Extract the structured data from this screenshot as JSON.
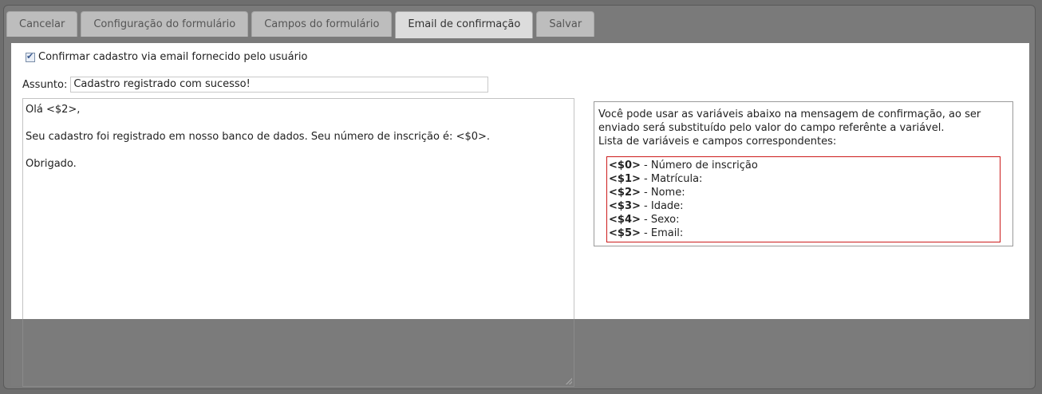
{
  "tabs": [
    {
      "label": "Cancelar"
    },
    {
      "label": "Configuração do formulário"
    },
    {
      "label": "Campos do formulário"
    },
    {
      "label": "Email de confirmação"
    },
    {
      "label": "Salvar"
    }
  ],
  "active_tab": "Email de confirmação",
  "confirm": {
    "checked": true,
    "label": "Confirmar cadastro via email fornecido pelo usuário"
  },
  "subject": {
    "label": "Assunto:",
    "value": "Cadastro registrado com sucesso!"
  },
  "message": {
    "lines": [
      "Olá <$2>,",
      "Seu cadastro foi registrado em nosso banco de dados. Seu número de inscrição é: <$0>.",
      "Obrigado."
    ]
  },
  "help": {
    "intro": "Você pode usar as variáveis abaixo na mensagem de confirmação, ao ser enviado será substituído pelo valor do campo referênte a variável.",
    "list_title": "Lista de variáveis e campos correspondentes:",
    "variables": [
      {
        "code": "<$0>",
        "field": "- Número de inscrição"
      },
      {
        "code": "<$1>",
        "field": "- Matrícula:"
      },
      {
        "code": "<$2>",
        "field": "- Nome:"
      },
      {
        "code": "<$3>",
        "field": "- Idade:"
      },
      {
        "code": "<$4>",
        "field": "- Sexo:"
      },
      {
        "code": "<$5>",
        "field": "- Email:"
      }
    ]
  },
  "colors": {
    "overlay": "#7b7b7b",
    "panel": "#ffffff",
    "var_border": "#cc1b1b"
  }
}
